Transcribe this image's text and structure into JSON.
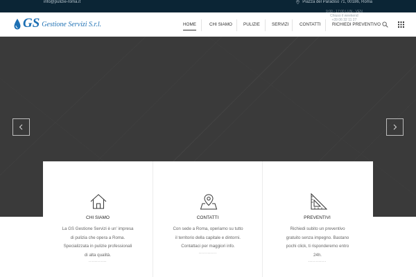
{
  "topbar": {
    "email": "info@pulizie-roma.it",
    "address": "Piazza del Paradiso 71, 00186, Roma"
  },
  "header": {
    "logo_mark": "GS",
    "logo_text": "Gestione Servizi S.r.l.",
    "hours_line1": "9:00 - 17:00 LUN - VEN",
    "hours_line2": "Chiuso il weekend",
    "hours_line3": "+39 06 32 11 27"
  },
  "nav": {
    "items": [
      {
        "label": "HOME",
        "active": true
      },
      {
        "label": "CHI SIAMO",
        "active": false
      },
      {
        "label": "PULIZIE",
        "active": false
      },
      {
        "label": "SERVIZI",
        "active": false
      },
      {
        "label": "CONTATTI",
        "active": false
      },
      {
        "label": "RICHIEDI PREVENTIVO",
        "active": false
      }
    ],
    "search_icon": "search-icon",
    "menu_icon": "grid-menu-icon"
  },
  "hero": {
    "prev_icon": "chevron-left-icon",
    "next_icon": "chevron-right-icon",
    "background_color": "#3a3a3a"
  },
  "cards": [
    {
      "icon": "home-icon",
      "title": "CHI SIAMO",
      "lines": [
        "La GS Gestione Servizi è un' impresa",
        "di pulizia che opera a Roma.",
        "Specializzata in pulizie professionali",
        "di alta qualità."
      ],
      "dots": "............"
    },
    {
      "icon": "map-pin-icon",
      "title": "CONTATTI",
      "lines": [
        "Con sede a Roma, operiamo su tutto",
        "il territorio della capitale e dintorni.",
        "Contattaci per maggiori info."
      ],
      "dots": "............"
    },
    {
      "icon": "ruler-triangle-icon",
      "title": "PREVENTIVI",
      "lines": [
        "Richiedi subito un preventivo",
        "gratuito senza impegno. Bastano",
        "pochi click, ti risponderemo entro",
        "24h."
      ],
      "dots": "............"
    }
  ],
  "colors": {
    "topbar": "#0b2535",
    "brand_blue": "#1c6fb3",
    "hero": "#3a3a3a"
  }
}
